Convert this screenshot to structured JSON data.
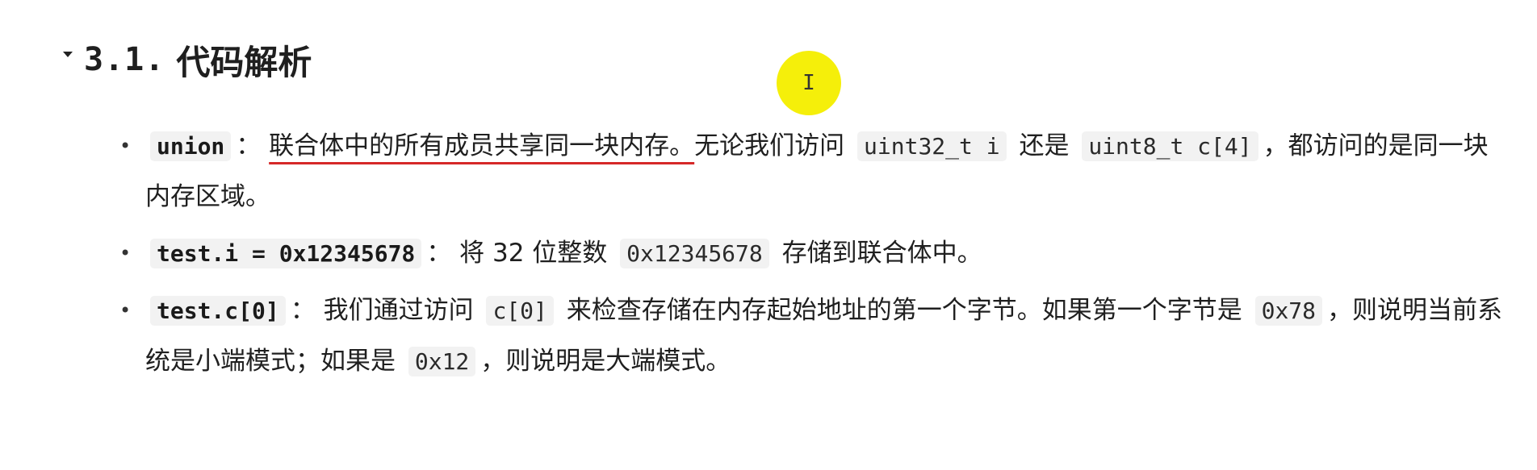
{
  "heading": {
    "number": "3.1.",
    "title": "代码解析"
  },
  "bullets": [
    {
      "code1": "union",
      "sep": "：",
      "underlined": "联合体中的所有成员共享同一块内存。",
      "text1": "无论我们访问",
      "code2": "uint32_t i",
      "text2": "还是",
      "code3": "uint8_t c[4]",
      "text3": "，都访问的是同一块内存区域。"
    },
    {
      "code1": "test.i = 0x12345678",
      "sep": "：",
      "text1": "将 32 位整数",
      "code2": "0x12345678",
      "text2": "存储到联合体中。"
    },
    {
      "code1": "test.c[0]",
      "sep": "：",
      "text1": "我们通过访问",
      "code2": "c[0]",
      "text2": "来检查存储在内存起始地址的第一个字节。如果第一个字节是",
      "code3": "0x78",
      "text3": "，则说明当前系统是小端模式；如果是",
      "code4": "0x12",
      "text4": "，则说明是大端模式。"
    }
  ]
}
